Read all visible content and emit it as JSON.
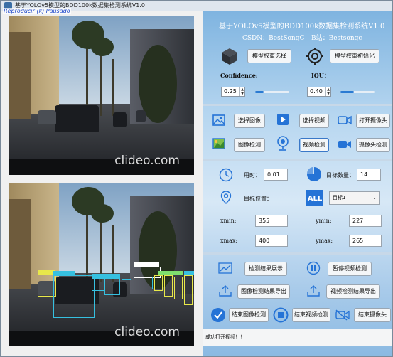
{
  "window": {
    "title": "基于YOLOv5模型的BDD100k数据集检测系统V1.0",
    "overlay_label": "Reproducir (k) Pausado"
  },
  "video": {
    "watermark_top": "clideo.com",
    "watermark_bottom": "clideo.com"
  },
  "header": {
    "title": "基于YOLOv5模型的BDD100k数据集检测系统V1.0",
    "csdn": "CSDN：BestSongC",
    "bilibili": "B站：Bestsongc"
  },
  "model": {
    "select_weights": "模型权重选择",
    "init_weights": "模型权重初始化"
  },
  "thresholds": {
    "confidence_label": "Confidence:",
    "confidence_value": "0.25",
    "confidence_level": 0.25,
    "iou_label": "IOU：",
    "iou_value": "0.40",
    "iou_level": 0.4
  },
  "inputs": {
    "select_image": "选择图像",
    "select_video": "选择视频",
    "open_camera": "打开摄像头",
    "detect_image": "图像检测",
    "detect_video": "视频检测",
    "detect_camera": "摄像头检测"
  },
  "results": {
    "time_label": "用时：",
    "time_value": "0.01",
    "count_label": "目标数量：",
    "count_value": "14",
    "position_label": "目标位置：",
    "target_select": "目标1",
    "xmin_label": "xmin:",
    "xmin_value": "355",
    "ymin_label": "ymin:",
    "ymin_value": "227",
    "xmax_label": "xmax:",
    "xmax_value": "400",
    "ymax_label": "ymax:",
    "ymax_value": "265"
  },
  "actions": {
    "show_results": "检测结果展示",
    "pause_video": "暂停视频检测",
    "export_image": "图像检测结果导出",
    "export_video": "视频检测结果导出",
    "end_image": "结束图像检测",
    "end_video": "结束视频检测",
    "end_camera": "结束摄像头"
  },
  "status": {
    "message": "成功打开视频！！"
  },
  "colors": {
    "accent": "#1f6fd1",
    "icon_blue": "#2573d6"
  }
}
